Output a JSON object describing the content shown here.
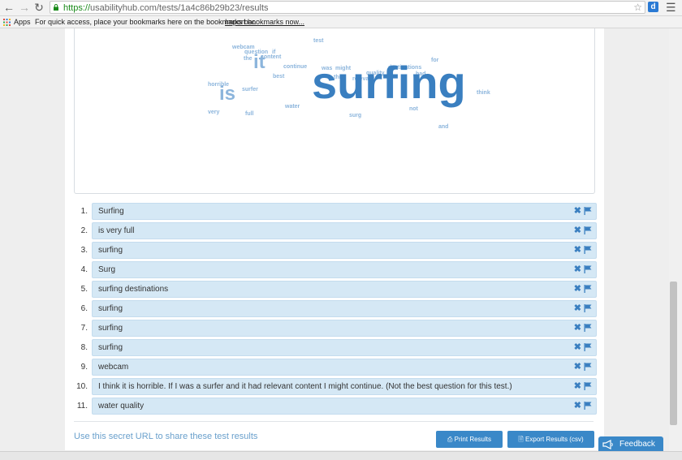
{
  "browser": {
    "url_scheme": "https://",
    "url_rest": "usabilityhub.com/tests/1a4c86b29b23/results",
    "apps_label": "Apps",
    "bookmarks_message": "For quick access, place your bookmarks here on the bookmarks bar.",
    "import_link": "Import bookmarks now...",
    "ext_label": "d"
  },
  "word_cloud": [
    {
      "text": "test",
      "size": 7
    },
    {
      "text": "webcam",
      "size": 7
    },
    {
      "text": "question",
      "size": 7
    },
    {
      "text": "if",
      "size": 7
    },
    {
      "text": "the",
      "size": 7
    },
    {
      "text": "content",
      "size": 7
    },
    {
      "text": "it",
      "size": 24
    },
    {
      "text": "continue",
      "size": 7
    },
    {
      "text": "best",
      "size": 7
    },
    {
      "text": "was",
      "size": 7
    },
    {
      "text": "might",
      "size": 7
    },
    {
      "text": "destinations",
      "size": 7
    },
    {
      "text": "for",
      "size": 7
    },
    {
      "text": "quality",
      "size": 7
    },
    {
      "text": "had",
      "size": 7
    },
    {
      "text": "this",
      "size": 7
    },
    {
      "text": "relevant",
      "size": 7
    },
    {
      "text": "surfing",
      "size": 56
    },
    {
      "text": "horrible",
      "size": 7
    },
    {
      "text": "surfer",
      "size": 7
    },
    {
      "text": "is",
      "size": 24
    },
    {
      "text": "think",
      "size": 7
    },
    {
      "text": "water",
      "size": 7
    },
    {
      "text": "very",
      "size": 7
    },
    {
      "text": "full",
      "size": 7
    },
    {
      "text": "not",
      "size": 7
    },
    {
      "text": "surg",
      "size": 7
    },
    {
      "text": "and",
      "size": 7
    }
  ],
  "responses": [
    {
      "num": "1.",
      "text": "Surfing"
    },
    {
      "num": "2.",
      "text": "is very full"
    },
    {
      "num": "3.",
      "text": "surfing"
    },
    {
      "num": "4.",
      "text": "Surg"
    },
    {
      "num": "5.",
      "text": "surfing destinations"
    },
    {
      "num": "6.",
      "text": "surfing"
    },
    {
      "num": "7.",
      "text": "surfing"
    },
    {
      "num": "8.",
      "text": "surfing"
    },
    {
      "num": "9.",
      "text": "webcam"
    },
    {
      "num": "10.",
      "text": "I think it is horrible. If I was a surfer and it had relevant content I might continue. (Not the best question for this test.)"
    },
    {
      "num": "11.",
      "text": "water quality"
    }
  ],
  "row_remove_glyph": "✖",
  "footer": {
    "share_text": "Use this secret URL to share these test results",
    "print_label": "Print Results",
    "export_label": "Export Results (csv)",
    "feedback_label": "Feedback"
  },
  "colors": {
    "accent": "#3a88c8",
    "row_bg": "#d5e8f5",
    "cloud_big": "#3a7fc0",
    "cloud_small": "#8cb5dc"
  }
}
